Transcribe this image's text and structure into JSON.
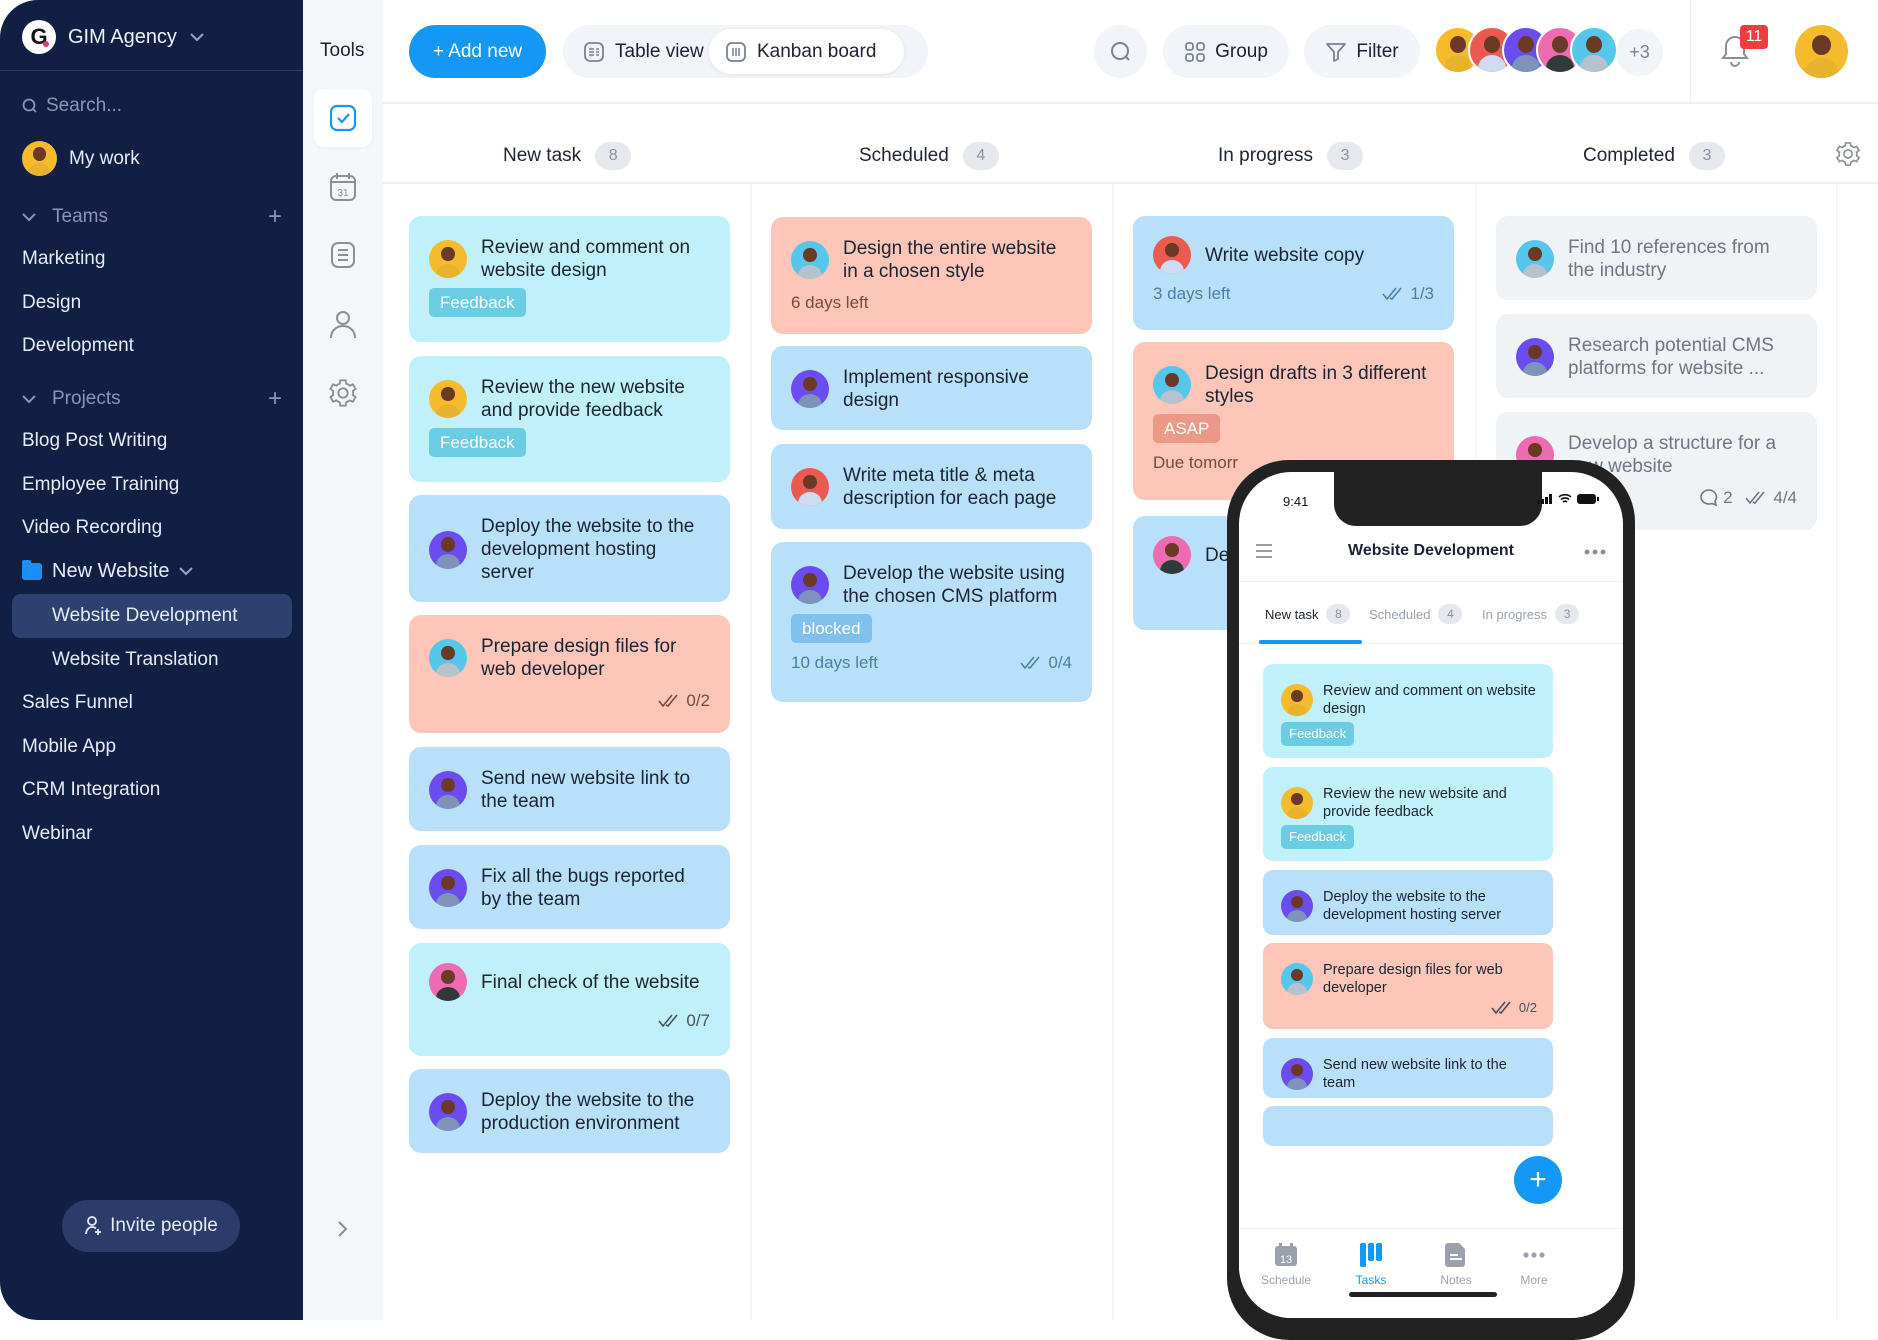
{
  "sidebar": {
    "org_name": "GIM Agency",
    "logo_letter": "G",
    "search_placeholder": "Search...",
    "my_work": "My work",
    "teams_label": "Teams",
    "teams": [
      "Marketing",
      "Design",
      "Development"
    ],
    "projects_label": "Projects",
    "projects": [
      "Blog Post Writing",
      "Employee Training",
      "Video Recording"
    ],
    "folder": {
      "label": "New Website",
      "children": [
        "Website Development",
        "Website Translation"
      ],
      "active": "Website Development"
    },
    "projects_after": [
      "Sales Funnel",
      "Mobile App",
      "CRM Integration",
      "Webinar"
    ],
    "invite_label": "Invite people"
  },
  "tools": {
    "label": "Tools",
    "items": [
      "tasks",
      "calendar",
      "notes",
      "people",
      "settings"
    ],
    "calendar_day": "31",
    "active": "tasks"
  },
  "toolbar": {
    "add_new": "+ Add new",
    "views": [
      "Table view",
      "Kanban board"
    ],
    "active_view": "Kanban board",
    "group": "Group",
    "filter": "Filter",
    "members_more": "+3",
    "notifications": "11"
  },
  "colors": {
    "accent": "#1597f5",
    "sidebar": "#111f45",
    "card_cyan": "#c0f0fa",
    "card_blue": "#b8e0fb",
    "card_salmon": "#fdc6b8",
    "card_grey": "#f0f3f5",
    "badge_red": "#f03d3d"
  },
  "board": {
    "columns": [
      {
        "name": "New task",
        "count": "8",
        "cards": [
          {
            "title": "Review and comment on website design",
            "avatar": "yellow",
            "color": "cyan",
            "tag": "Feedback"
          },
          {
            "title": "Review the new website and provide feedback",
            "avatar": "yellow",
            "color": "cyan",
            "tag": "Feedback"
          },
          {
            "title": "Deploy the website to the development hosting server",
            "avatar": "purple",
            "color": "blue"
          },
          {
            "title": "Prepare design files for web developer",
            "avatar": "cyan",
            "color": "salmon",
            "checks": "0/2"
          },
          {
            "title": "Send new website link to the team",
            "avatar": "purple",
            "color": "blue"
          },
          {
            "title": "Fix all the bugs reported by the team",
            "avatar": "purple",
            "color": "blue"
          },
          {
            "title": "Final check of the website",
            "avatar": "pink",
            "color": "cyan",
            "checks": "0/7"
          },
          {
            "title": "Deploy the website to the production environment",
            "avatar": "purple",
            "color": "blue"
          }
        ]
      },
      {
        "name": "Scheduled",
        "count": "4",
        "cards": [
          {
            "title": "Design the entire website in a chosen style",
            "avatar": "cyan",
            "color": "salmon",
            "due": "6 days left"
          },
          {
            "title": "Implement responsive design",
            "avatar": "purple",
            "color": "blue"
          },
          {
            "title": "Write meta title & meta description for each page",
            "avatar": "red",
            "color": "blue"
          },
          {
            "title": "Develop the website using the chosen CMS platform",
            "avatar": "purple",
            "color": "blue",
            "tag": "blocked",
            "due": "10 days left",
            "checks": "0/4"
          }
        ]
      },
      {
        "name": "In progress",
        "count": "3",
        "cards": [
          {
            "title": "Write website copy",
            "avatar": "red",
            "color": "blue",
            "due": "3 days left",
            "checks": "1/3"
          },
          {
            "title": "Design drafts in 3 different styles",
            "avatar": "cyan",
            "color": "salmon",
            "tag": "ASAP",
            "due": "Due tomorr"
          },
          {
            "title": "De",
            "avatar": "pink",
            "color": "blue"
          }
        ]
      },
      {
        "name": "Completed",
        "count": "3",
        "cards": [
          {
            "title": "Find 10 references from the industry",
            "avatar": "cyan",
            "color": "grey"
          },
          {
            "title": "Research potential CMS platforms for website ...",
            "avatar": "purple",
            "color": "grey"
          },
          {
            "title": "Develop a structure for a new website",
            "avatar": "pink",
            "color": "grey",
            "comments": "2",
            "checks": "4/4"
          }
        ]
      }
    ]
  },
  "phone": {
    "time": "9:41",
    "title": "Website Development",
    "tabs": [
      {
        "label": "New task",
        "count": "8"
      },
      {
        "label": "Scheduled",
        "count": "4"
      },
      {
        "label": "In progress",
        "count": "3"
      }
    ],
    "active_tab": "New task",
    "cards": [
      {
        "title": "Review and comment on website design",
        "tag": "Feedback"
      },
      {
        "title": "Review the new website and provide feedback",
        "tag": "Feedback"
      },
      {
        "title": "Deploy the website to the development hosting server"
      },
      {
        "title": "Prepare design files for web developer",
        "checks": "0/2"
      },
      {
        "title": "Send new website link to the team"
      }
    ],
    "nav": [
      "Schedule",
      "Tasks",
      "Notes",
      "More"
    ],
    "nav_active": "Tasks",
    "schedule_day": "13"
  }
}
